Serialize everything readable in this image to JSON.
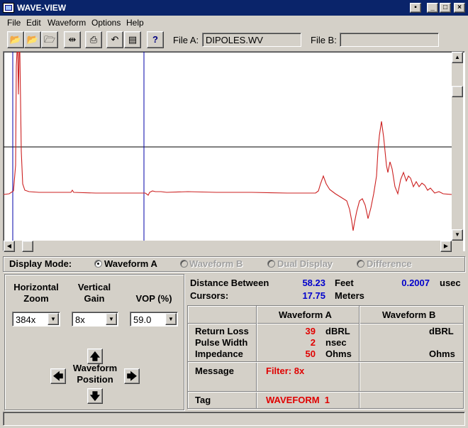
{
  "window": {
    "title": "WAVE-VIEW"
  },
  "menu": [
    "File",
    "Edit",
    "Waveform",
    "Options",
    "Help"
  ],
  "toolbar": {
    "tools": [
      {
        "name": "open-file-a-icon",
        "glyph": "📂"
      },
      {
        "name": "open-file-b-icon",
        "glyph": "📂"
      },
      {
        "name": "open-folder-icon",
        "glyph": "🗁"
      },
      {
        "name": "compare-icon",
        "glyph": "⇹"
      },
      {
        "name": "print-icon",
        "glyph": "⎙"
      },
      {
        "name": "undo-icon",
        "glyph": "↶"
      },
      {
        "name": "clipboard-icon",
        "glyph": "▤"
      },
      {
        "name": "help-icon",
        "glyph": "?"
      }
    ],
    "file_a_label": "File A:",
    "file_a_value": "DIPOLES.WV",
    "file_b_label": "File B:",
    "file_b_value": ""
  },
  "display_mode": {
    "label": "Display Mode:",
    "options": [
      {
        "label": "Waveform A",
        "selected": true,
        "enabled": true
      },
      {
        "label": "Waveform B",
        "selected": false,
        "enabled": false
      },
      {
        "label": "Dual Display",
        "selected": false,
        "enabled": false
      },
      {
        "label": "Difference",
        "selected": false,
        "enabled": false
      }
    ]
  },
  "controls": {
    "horizontal_zoom": {
      "label_1": "Horizontal",
      "label_2": "Zoom",
      "value": "384x"
    },
    "vertical_gain": {
      "label_1": "Vertical",
      "label_2": "Gain",
      "value": "8x"
    },
    "vop": {
      "label": "VOP (%)",
      "value": "59.0"
    },
    "waveform_position": {
      "label_1": "Waveform",
      "label_2": "Position"
    }
  },
  "cursors": {
    "label_1": "Distance Between",
    "label_2": "Cursors:",
    "feet_value": "58.23",
    "feet_unit": "Feet",
    "meters_value": "17.75",
    "meters_unit": "Meters",
    "usec_value": "0.2007",
    "usec_unit": "usec"
  },
  "table": {
    "header_a": "Waveform A",
    "header_b": "Waveform B",
    "rows": [
      {
        "label": "Return Loss",
        "a_value": "39",
        "a_unit": "dBRL",
        "b_unit": "dBRL"
      },
      {
        "label": "Pulse Width",
        "a_value": "2",
        "a_unit": "nsec",
        "b_unit": ""
      },
      {
        "label": "Impedance",
        "a_value": "50",
        "a_unit": "Ohms",
        "b_unit": "Ohms"
      }
    ],
    "message_label": "Message",
    "message_a": "Filter: 8x",
    "tag_label": "Tag",
    "tag_a": "WAVEFORM  1"
  },
  "colors": {
    "trace": "#cc2020",
    "cursor": "#0000aa",
    "hline": "#000000",
    "value_blue": "#0000cc",
    "value_red": "#e00000"
  }
}
